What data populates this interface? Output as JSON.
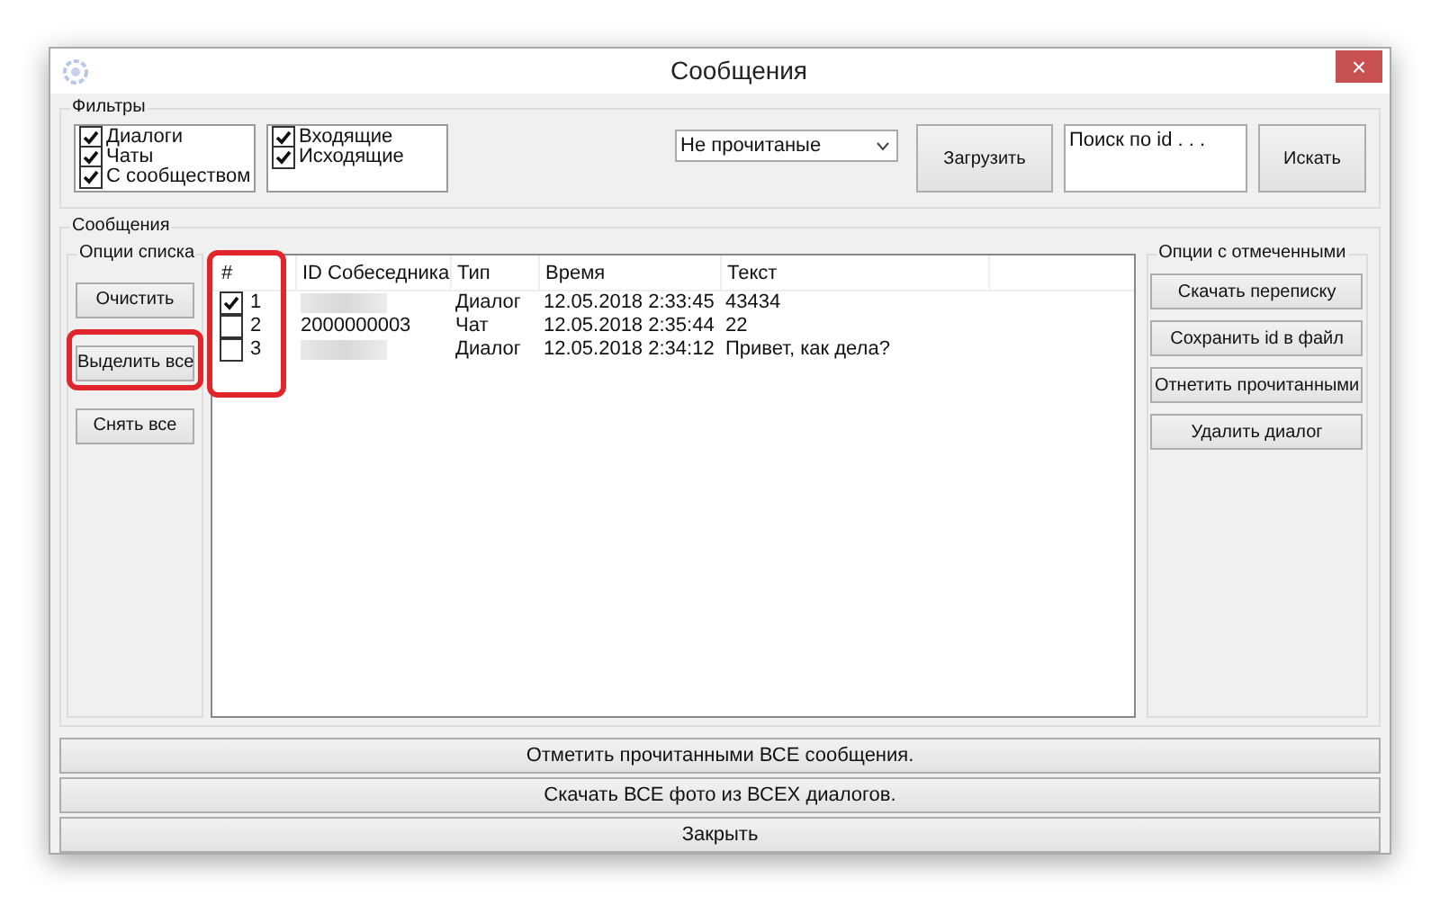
{
  "window": {
    "title": "Сообщения",
    "close": "×"
  },
  "filters": {
    "title": "Фильтры",
    "types": [
      {
        "label": "Диалоги",
        "checked": true
      },
      {
        "label": "Чаты",
        "checked": true
      },
      {
        "label": "С сообществом",
        "checked": true
      }
    ],
    "directions": [
      {
        "label": "Входящие",
        "checked": true
      },
      {
        "label": "Исходящие",
        "checked": true
      }
    ],
    "status_select": {
      "value": "Не прочитаные"
    },
    "load_button": "Загрузить",
    "search": {
      "placeholder": "Поиск по id . . ."
    },
    "search_button": "Искать"
  },
  "messages": {
    "title": "Сообщения",
    "list_options": {
      "title": "Опции списка",
      "buttons": [
        {
          "label": "Очистить",
          "highlighted": false
        },
        {
          "label": "Выделить все",
          "highlighted": true
        },
        {
          "label": "Снять все",
          "highlighted": false
        }
      ]
    },
    "table": {
      "columns": [
        "#",
        "ID Собеседника",
        "Тип",
        "Время",
        "Текст"
      ],
      "checkbox_column_highlighted": true,
      "rows": [
        {
          "checked": true,
          "number": "1",
          "id": null,
          "type": "Диалог",
          "time": "12.05.2018 2:33:45",
          "text": "43434"
        },
        {
          "checked": false,
          "number": "2",
          "id": "2000000003",
          "type": "Чат",
          "time": "12.05.2018 2:35:44",
          "text": "22"
        },
        {
          "checked": false,
          "number": "3",
          "id": null,
          "type": "Диалог",
          "time": "12.05.2018 2:34:12",
          "text": "Привет, как дела?"
        }
      ]
    },
    "checked_options": {
      "title": "Опции с отмеченными",
      "buttons": [
        "Скачать переписку",
        "Сохранить id в файл",
        "Отнетить прочитанными",
        "Удалить диалог"
      ]
    }
  },
  "bottom_buttons": [
    "Отметить прочитанными ВСЕ сообщения.",
    "Скачать ВСЕ фото из ВСЕХ диалогов.",
    "Закрыть"
  ]
}
